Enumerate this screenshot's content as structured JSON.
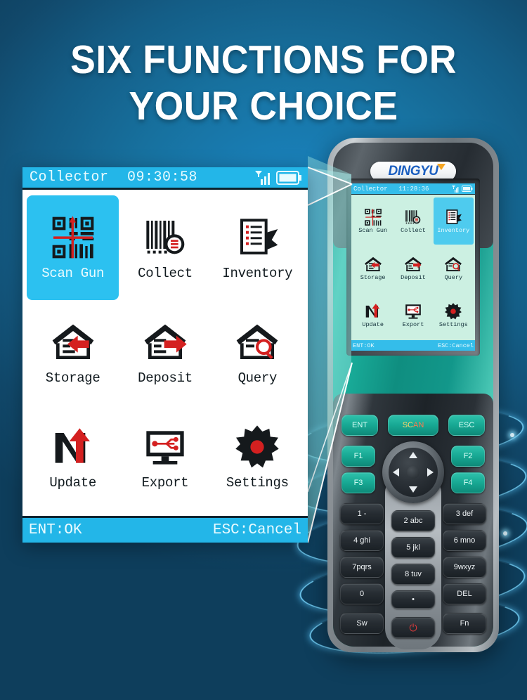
{
  "headline": "SIX FUNCTIONS FOR\nYOUR CHOICE",
  "colors": {
    "background_top": "#1a4f7a",
    "background_center": "#1a86c4",
    "accent_cyan": "#23b6e8",
    "selection_cyan": "#2cc1f0",
    "icon_red": "#d42020",
    "device_teal": "#19ab98",
    "logo_blue": "#1b5fc0",
    "logo_orange": "#f5a623",
    "glow_blue": "#78d7ff"
  },
  "panel": {
    "status_bar": {
      "title": "Collector",
      "time": "09:30:58",
      "signal_icon": "signal-bars-icon",
      "battery_icon": "battery-icon"
    },
    "menu": [
      {
        "label": "Scan Gun",
        "icon": "qr-scan-icon",
        "selected": true
      },
      {
        "label": "Collect",
        "icon": "barcode-icon",
        "selected": false
      },
      {
        "label": "Inventory",
        "icon": "clipboard-icon",
        "selected": false
      },
      {
        "label": "Storage",
        "icon": "house-in-icon",
        "selected": false
      },
      {
        "label": "Deposit",
        "icon": "house-out-icon",
        "selected": false
      },
      {
        "label": "Query",
        "icon": "house-search-icon",
        "selected": false
      },
      {
        "label": "Update",
        "icon": "n-arrow-up-icon",
        "selected": false
      },
      {
        "label": "Export",
        "icon": "monitor-usb-icon",
        "selected": false
      },
      {
        "label": "Settings",
        "icon": "gear-icon",
        "selected": false
      }
    ],
    "footer": {
      "left": "ENT:OK",
      "right": "ESC:Cancel"
    }
  },
  "device": {
    "brand": "DINGYU",
    "screen": {
      "status_bar": {
        "title": "Collector",
        "time": "11:28:36",
        "signal_icon": "signal-bars-icon",
        "battery_icon": "battery-icon"
      },
      "menu": [
        {
          "label": "Scan Gun",
          "icon": "qr-scan-icon",
          "selected": false
        },
        {
          "label": "Collect",
          "icon": "barcode-icon",
          "selected": false
        },
        {
          "label": "Inventory",
          "icon": "clipboard-icon",
          "selected": true
        },
        {
          "label": "Storage",
          "icon": "house-in-icon",
          "selected": false
        },
        {
          "label": "Deposit",
          "icon": "house-out-icon",
          "selected": false
        },
        {
          "label": "Query",
          "icon": "house-search-icon",
          "selected": false
        },
        {
          "label": "Update",
          "icon": "n-arrow-up-icon",
          "selected": false
        },
        {
          "label": "Export",
          "icon": "monitor-usb-icon",
          "selected": false
        },
        {
          "label": "Settings",
          "icon": "gear-icon",
          "selected": false
        }
      ],
      "footer": {
        "left": "ENT:OK",
        "right": "ESC:Cancel"
      }
    },
    "keys": {
      "ent": "ENT",
      "scan": "SCAN",
      "esc": "ESC",
      "f1": "F1",
      "f2": "F2",
      "f3": "F3",
      "f4": "F4",
      "k1": "1 -",
      "k2": "2 abc",
      "k3": "3 def",
      "k4": "4 ghi",
      "k5": "5 jkl",
      "k6": "6 mno",
      "k7": "7pqrs",
      "k8": "8 tuv",
      "k9": "9wxyz",
      "k0": "0",
      "dot": "•",
      "del": "DEL",
      "sw": "Sw",
      "fn": "Fn",
      "power": "⏻"
    }
  }
}
